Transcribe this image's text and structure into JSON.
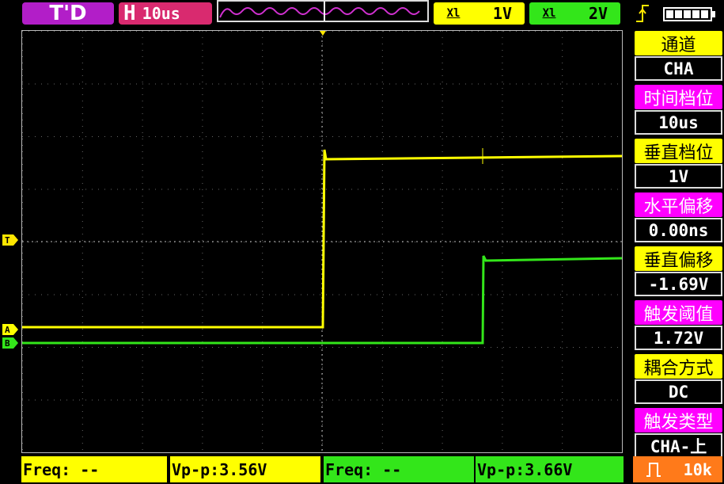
{
  "top_bar": {
    "mode": "T'D",
    "timebase_prefix": "H",
    "timebase": "10us",
    "channel_a": {
      "coupling": "Xl",
      "scale": "1V"
    },
    "channel_b": {
      "coupling": "Xl",
      "scale": "2V"
    },
    "trigger_edge_icon": "rising-edge-icon",
    "battery_icon": "battery-full-icon"
  },
  "markers": {
    "trigger": "T",
    "channel_a": "A",
    "channel_b": "B"
  },
  "menu": [
    {
      "label": "通道",
      "value": "CHA",
      "color": "#ffff00"
    },
    {
      "label": "时间档位",
      "value": "10us",
      "color": "#ff00ff"
    },
    {
      "label": "垂直档位",
      "value": "1V",
      "color": "#ffff00"
    },
    {
      "label": "水平偏移",
      "value": "0.00ns",
      "color": "#ff00ff"
    },
    {
      "label": "垂直偏移",
      "value": "-1.69V",
      "color": "#ffff00"
    },
    {
      "label": "触发阈值",
      "value": "1.72V",
      "color": "#ff00ff"
    },
    {
      "label": "耦合方式",
      "value": "DC",
      "color": "#ffff00"
    },
    {
      "label": "触发类型",
      "value": "CHA-上",
      "color": "#ff00ff"
    }
  ],
  "bottom_bar": {
    "cha_freq": "Freq: --",
    "cha_vpp": "Vp-p:3.56V",
    "chb_freq": "Freq: --",
    "chb_vpp": "Vp-p:3.66V",
    "signal_icon": "square-wave-icon",
    "signal_freq": "10k"
  },
  "colors": {
    "channel_a": "#ffff00",
    "channel_b": "#33e61a",
    "accent": "#b21ec8"
  }
}
